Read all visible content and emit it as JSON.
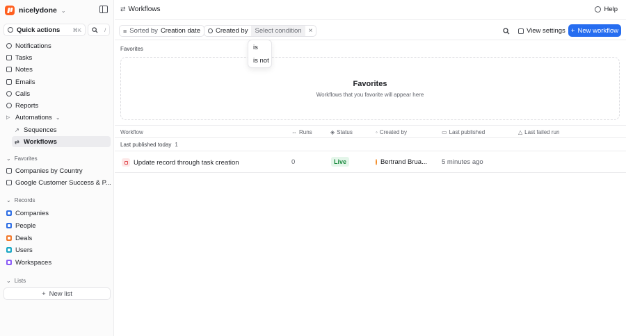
{
  "workspace": {
    "name": "nicelydone"
  },
  "quick_actions": {
    "label": "Quick actions",
    "shortcut": "⌘K",
    "slash": "/"
  },
  "nav": [
    {
      "label": "Notifications",
      "icon": "bell-icon"
    },
    {
      "label": "Tasks",
      "icon": "checkbox-icon"
    },
    {
      "label": "Notes",
      "icon": "note-icon"
    },
    {
      "label": "Emails",
      "icon": "mail-icon"
    },
    {
      "label": "Calls",
      "icon": "phone-icon"
    },
    {
      "label": "Reports",
      "icon": "chart-icon"
    },
    {
      "label": "Automations",
      "icon": "play-icon"
    }
  ],
  "automations_sub": [
    {
      "label": "Sequences",
      "icon": "sequence-icon"
    },
    {
      "label": "Workflows",
      "icon": "workflow-icon",
      "active": true
    }
  ],
  "favorites_section": {
    "title": "Favorites",
    "items": [
      {
        "label": "Companies by Country"
      },
      {
        "label": "Google Customer Success & P..."
      }
    ]
  },
  "records_section": {
    "title": "Records",
    "items": [
      {
        "label": "Companies",
        "color": "#2f6fe4"
      },
      {
        "label": "People",
        "color": "#2f6fe4"
      },
      {
        "label": "Deals",
        "color": "#f2792b"
      },
      {
        "label": "Users",
        "color": "#1aa7c4"
      },
      {
        "label": "Workspaces",
        "color": "#8b5cf6"
      }
    ]
  },
  "lists_section": {
    "title": "Lists",
    "new_list": "New list"
  },
  "header": {
    "breadcrumb": "Workflows",
    "help": "Help"
  },
  "toolbar": {
    "sort_prefix": "Sorted by",
    "sort_field": "Creation date",
    "filter_field": "Created by",
    "filter_condition": "Select condition",
    "view_settings": "View settings",
    "new_workflow": "New workflow"
  },
  "condition_menu": [
    "is",
    "is not"
  ],
  "favorites_panel": {
    "label": "Favorites",
    "empty_title": "Favorites",
    "empty_subtitle": "Workflows that you favorite will appear here"
  },
  "table": {
    "columns": [
      "Workflow",
      "Runs",
      "Status",
      "Created by",
      "Last published",
      "Last failed run"
    ],
    "group": {
      "label": "Last published today",
      "count": "1"
    },
    "rows": [
      {
        "workflow": "Update record through task creation",
        "runs": "0",
        "status": "Live",
        "created_by": "Bertrand Brua...",
        "last_published": "5 minutes ago",
        "last_failed_run": ""
      }
    ]
  },
  "colors": {
    "accent": "#266df0",
    "live_bg": "#e4f6ea",
    "live_text": "#1b8a3f",
    "brand": "#ff5f1f"
  }
}
